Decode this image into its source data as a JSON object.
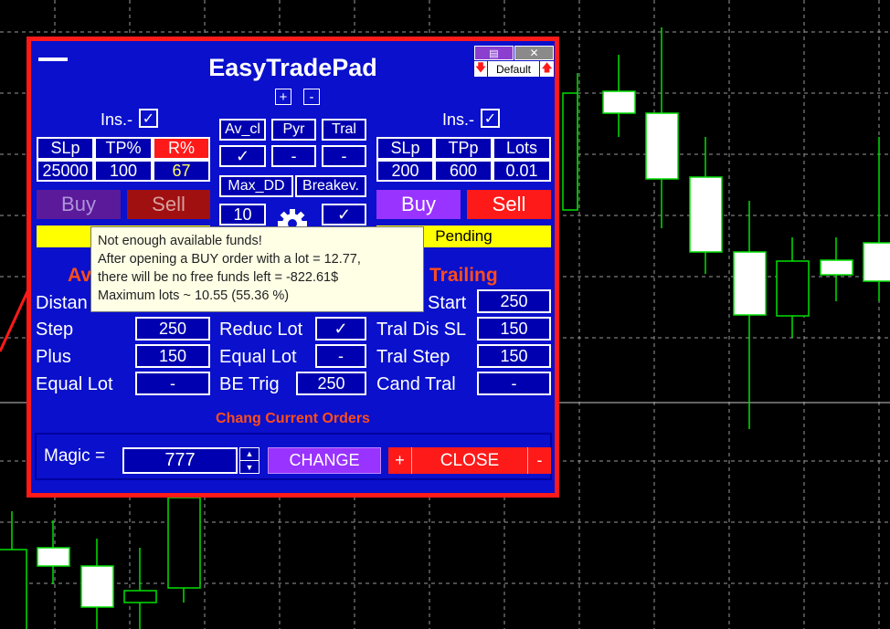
{
  "panel": {
    "title": "EasyTradePad",
    "profile_label": "Default",
    "zoom_in": "+",
    "zoom_out": "-"
  },
  "left_block": {
    "ins_label": "Ins.-",
    "ins_checked": "✓",
    "headers": [
      "SLp",
      "TP%",
      "R%"
    ],
    "values": [
      "25000",
      "100",
      "67"
    ],
    "buy_label": "Buy",
    "sell_label": "Sell"
  },
  "center_block": {
    "row1_headers": [
      "Av_cl",
      "Pyr",
      "Tral"
    ],
    "row1_values": [
      "✓",
      "-",
      "-"
    ],
    "max_dd_label": "Max_DD",
    "breakeven_label": "Breakev.",
    "max_dd_value": "10",
    "breakeven_value": "✓"
  },
  "right_block": {
    "ins_label": "Ins.-",
    "ins_checked": "✓",
    "headers": [
      "SLp",
      "TPp",
      "Lots"
    ],
    "values": [
      "200",
      "600",
      "0.01"
    ],
    "buy_label": "Buy",
    "sell_label": "Sell",
    "pending_label": "Pending"
  },
  "averaging": {
    "title_visible": "Av",
    "rows": [
      {
        "label": "Distan",
        "value": ""
      },
      {
        "label": "Step",
        "value": "250"
      },
      {
        "label": "Plus",
        "value": "150"
      },
      {
        "label": "Equal Lot",
        "value": "-"
      }
    ]
  },
  "middle_params": [
    {
      "label": "Reduc Lot",
      "value": "✓"
    },
    {
      "label": "Equal Lot",
      "value": "-"
    },
    {
      "label": "BE Trig",
      "value": "250"
    }
  ],
  "trailing": {
    "title": "Trailing",
    "rows": [
      {
        "label": "Start",
        "value": "250"
      },
      {
        "label": "Tral Dis SL",
        "value": "150"
      },
      {
        "label": "Tral Step",
        "value": "150"
      },
      {
        "label": "Cand Tral",
        "value": "-"
      }
    ]
  },
  "orders": {
    "title": "Chang Current Orders",
    "magic_label": "Magic =",
    "magic_value": "777",
    "change_label": "CHANGE",
    "close_label": "CLOSE",
    "plus_label": "+",
    "minus_label": "-"
  },
  "tooltip": {
    "lines": [
      "Not enough available funds!",
      "After opening a BUY order with a lot = 12.77,",
      "there will be no free funds left = -822.61$",
      "Maximum lots ~ 10.55 (55.36 %)"
    ]
  },
  "colors": {
    "panel_bg": "#0a10cc",
    "border": "#ff1a1a",
    "buy": "#9933ff",
    "sell": "#ff1a1a",
    "pending": "#ffff00",
    "section_title": "#ff4d1a",
    "tooltip_bg": "#ffffe6"
  }
}
